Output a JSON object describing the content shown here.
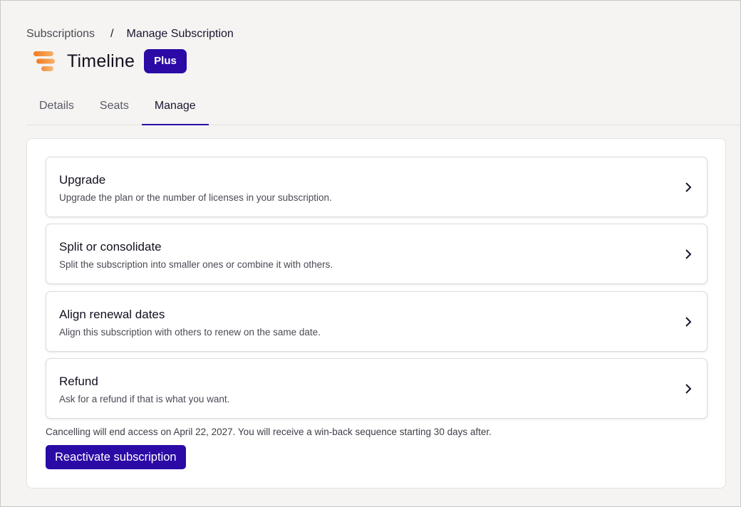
{
  "breadcrumb": {
    "parent": "Subscriptions",
    "separator": "/",
    "current": "Manage Subscription"
  },
  "header": {
    "logo_icon": "timeline-logo-icon",
    "title": "Timeline",
    "plan_badge": "Plus"
  },
  "tabs": [
    {
      "label": "Details",
      "active": false
    },
    {
      "label": "Seats",
      "active": false
    },
    {
      "label": "Manage",
      "active": true
    }
  ],
  "options": [
    {
      "title": "Upgrade",
      "description": "Upgrade the plan or the number of licenses in your subscription.",
      "icon": "chevron-right-icon"
    },
    {
      "title": "Split or consolidate",
      "description": "Split the subscription into smaller ones or combine it with others.",
      "icon": "chevron-right-icon"
    },
    {
      "title": "Align renewal dates",
      "description": "Align this subscription with others to renew on the same date.",
      "icon": "chevron-right-icon"
    },
    {
      "title": "Refund",
      "description": "Ask for a refund if that is what you want.",
      "icon": "chevron-right-icon"
    }
  ],
  "cancel_note": "Cancelling will end access on April 22, 2027. You will receive a win-back sequence starting 30 days after.",
  "reactivate_label": "Reactivate subscription",
  "colors": {
    "accent": "#2b0aa6",
    "logo_orange": "#f0892a",
    "background": "#f5f4f2"
  }
}
